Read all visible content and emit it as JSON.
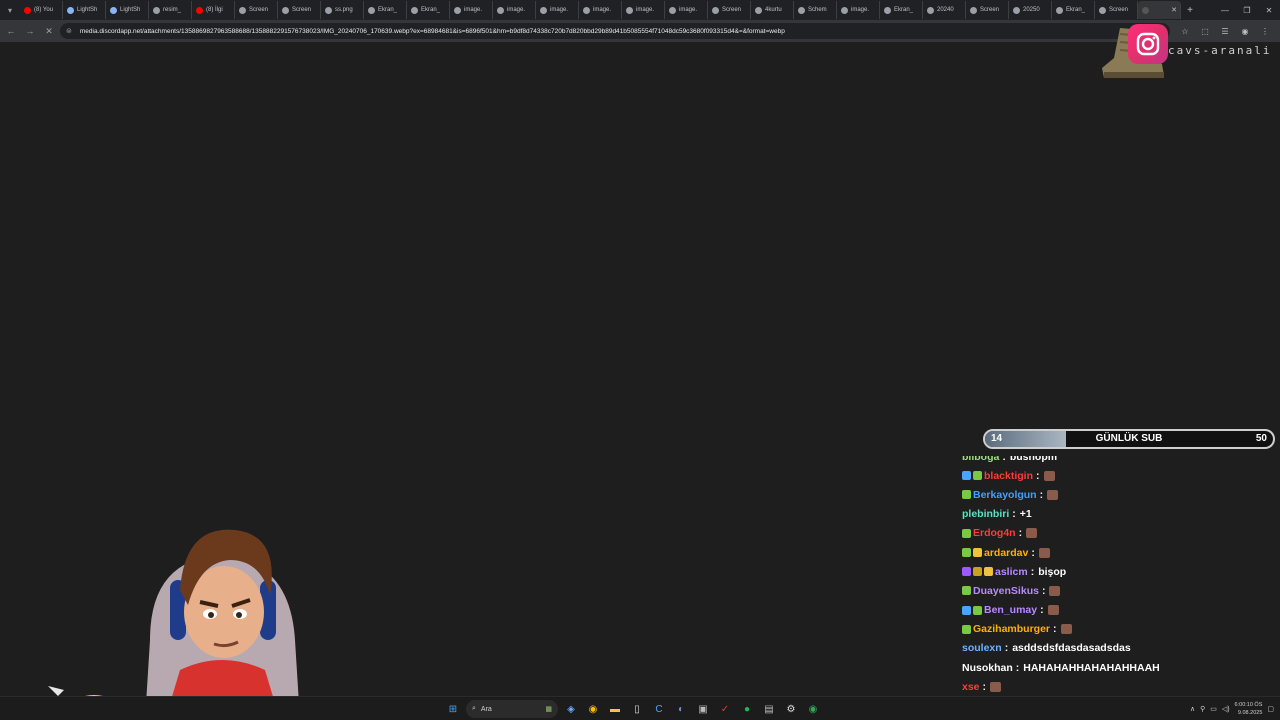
{
  "browser": {
    "tabs": [
      {
        "label": "(8) You",
        "color": "#ff0000"
      },
      {
        "label": "LightSh",
        "color": "#8ab4f8"
      },
      {
        "label": "LightSh",
        "color": "#8ab4f8"
      },
      {
        "label": "resim_",
        "color": "#9aa0a6"
      },
      {
        "label": "(8) İlgi",
        "color": "#ff0000"
      },
      {
        "label": "Screen",
        "color": "#9aa0a6"
      },
      {
        "label": "Screen",
        "color": "#9aa0a6"
      },
      {
        "label": "ss.png",
        "color": "#9aa0a6"
      },
      {
        "label": "Ekran_",
        "color": "#9aa0a6"
      },
      {
        "label": "Ekran_",
        "color": "#9aa0a6"
      },
      {
        "label": "image.",
        "color": "#9aa0a6"
      },
      {
        "label": "image.",
        "color": "#9aa0a6"
      },
      {
        "label": "image.",
        "color": "#9aa0a6"
      },
      {
        "label": "image.",
        "color": "#9aa0a6"
      },
      {
        "label": "image.",
        "color": "#9aa0a6"
      },
      {
        "label": "image.",
        "color": "#9aa0a6"
      },
      {
        "label": "Screen",
        "color": "#9aa0a6"
      },
      {
        "label": "4kurtu",
        "color": "#9aa0a6"
      },
      {
        "label": "Schem",
        "color": "#9aa0a6"
      },
      {
        "label": "image.",
        "color": "#9aa0a6"
      },
      {
        "label": "Ekran_",
        "color": "#9aa0a6"
      },
      {
        "label": "20240",
        "color": "#9aa0a6"
      },
      {
        "label": "Screen",
        "color": "#9aa0a6"
      },
      {
        "label": "20250",
        "color": "#9aa0a6"
      },
      {
        "label": "Ekran_",
        "color": "#9aa0a6"
      },
      {
        "label": "Screen",
        "color": "#9aa0a6"
      }
    ],
    "active_tab_label": "",
    "url": "media.discordapp.net/attachments/1358869827963588688/1358882291576738023/IMG_20240706_170639.webp?ex=68984681&is=6896f501&hm=b9df8d74338c720b7d820bbd29b89d41b5085554f71048dc59c3680f093315d4&=&format=webp"
  },
  "overlay": {
    "instagram_handle": "cavs-aranali",
    "sub_goal": {
      "label": "GÜNLÜK SUB",
      "current": "14",
      "max": "50",
      "progress": 0.28
    }
  },
  "chat": [
    {
      "user": "bilboga",
      "color": "#9be07a",
      "message": "bushopm",
      "badges": []
    },
    {
      "user": "blacktigin",
      "color": "#ff3b3b",
      "message": "",
      "emote": true,
      "badges": [
        "#4aa3ff",
        "#7ac943"
      ]
    },
    {
      "user": "Berkayolgun",
      "color": "#3fa0ff",
      "message": "",
      "emote": true,
      "badges": [
        "#7ac943"
      ]
    },
    {
      "user": "plebinbiri",
      "color": "#5fe0c0",
      "message": "+1",
      "badges": []
    },
    {
      "user": "Erdog4n",
      "color": "#ff3b3b",
      "message": "",
      "emote": true,
      "badges": [
        "#7ac943"
      ]
    },
    {
      "user": "ardardav",
      "color": "#ffb000",
      "message": "",
      "emote": true,
      "badges": [
        "#7ac943",
        "#f0c040"
      ]
    },
    {
      "user": "aslicm",
      "color": "#b98aff",
      "message": "bişop",
      "badges": [
        "#9b59ff",
        "#c9a020",
        "#f0c040"
      ]
    },
    {
      "user": "DuayenSikus",
      "color": "#b98aff",
      "message": "",
      "emote": true,
      "badges": [
        "#7ac943"
      ]
    },
    {
      "user": "Ben_umay",
      "color": "#b98aff",
      "message": "",
      "emote": true,
      "badges": [
        "#4aa3ff",
        "#7ac943"
      ]
    },
    {
      "user": "Gazihamburger",
      "color": "#ffb000",
      "message": "",
      "emote": true,
      "badges": [
        "#7ac943"
      ]
    },
    {
      "user": "soulexn",
      "color": "#6fb2ff",
      "message": "asddsdsfdasdasadsdas",
      "badges": []
    },
    {
      "user": "Nusokhan",
      "color": "#ffffff",
      "message": "HAHAHAHHAHAHAHHAAH",
      "badges": []
    },
    {
      "user": "xse",
      "color": "#ff3b3b",
      "message": "",
      "emote": true,
      "badges": []
    }
  ],
  "taskbar": {
    "search_placeholder": "Ara",
    "time": "6:00:10 ÖS",
    "date": "9.08.2025"
  }
}
